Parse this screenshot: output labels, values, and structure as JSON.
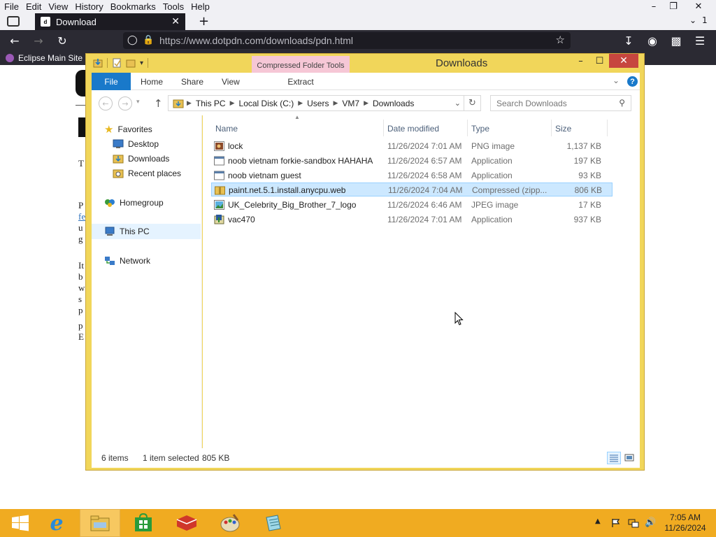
{
  "browser": {
    "menu": [
      "File",
      "Edit",
      "View",
      "History",
      "Bookmarks",
      "Tools",
      "Help"
    ],
    "tab_title": "Download",
    "tab_count": "1",
    "url": "https://www.dotpdn.com/downloads/pdn.html",
    "bookmark": "Eclipse Main Site"
  },
  "page_fragments": {
    "lines": [
      "T",
      "P",
      "fe",
      "u",
      "g",
      "It",
      "b",
      "w",
      "s",
      "p",
      "p",
      "E"
    ]
  },
  "explorer": {
    "title": "Downloads",
    "context_tab": "Compressed Folder Tools",
    "ribbon_tabs": [
      "File",
      "Home",
      "Share",
      "View"
    ],
    "context_subtab": "Extract",
    "breadcrumb": [
      "This PC",
      "Local Disk (C:)",
      "Users",
      "VM7",
      "Downloads"
    ],
    "search_placeholder": "Search Downloads",
    "nav": {
      "favorites": "Favorites",
      "desktop": "Desktop",
      "downloads": "Downloads",
      "recent": "Recent places",
      "homegroup": "Homegroup",
      "thispc": "This PC",
      "network": "Network"
    },
    "columns": {
      "name": "Name",
      "date": "Date modified",
      "type": "Type",
      "size": "Size"
    },
    "files": [
      {
        "name": "lock",
        "date": "11/26/2024 7:01 AM",
        "type": "PNG image",
        "size": "1,137 KB",
        "icon": "png-image-icon"
      },
      {
        "name": "noob vietnam forkie-sandbox HAHAHA",
        "date": "11/26/2024 6:57 AM",
        "type": "Application",
        "size": "197 KB",
        "icon": "application-icon"
      },
      {
        "name": "noob vietnam guest",
        "date": "11/26/2024 6:58 AM",
        "type": "Application",
        "size": "93 KB",
        "icon": "application-icon"
      },
      {
        "name": "paint.net.5.1.install.anycpu.web",
        "date": "11/26/2024 7:04 AM",
        "type": "Compressed (zipp...",
        "size": "806 KB",
        "icon": "zip-folder-icon",
        "selected": true
      },
      {
        "name": "UK_Celebrity_Big_Brother_7_logo",
        "date": "11/26/2024 6:46 AM",
        "type": "JPEG image",
        "size": "17 KB",
        "icon": "jpeg-image-icon"
      },
      {
        "name": "vac470",
        "date": "11/26/2024 7:01 AM",
        "type": "Application",
        "size": "937 KB",
        "icon": "installer-icon"
      }
    ],
    "status": {
      "items": "6 items",
      "selected": "1 item selected",
      "size": "805 KB"
    }
  },
  "taskbar": {
    "time": "7:05 AM",
    "date": "11/26/2024"
  },
  "colors": {
    "explorer_frame": "#f1d65a",
    "taskbar": "#f0ab21",
    "ribbon_file": "#1979ca",
    "selection": "#cce8ff",
    "context_tab": "#f6c7d6"
  }
}
